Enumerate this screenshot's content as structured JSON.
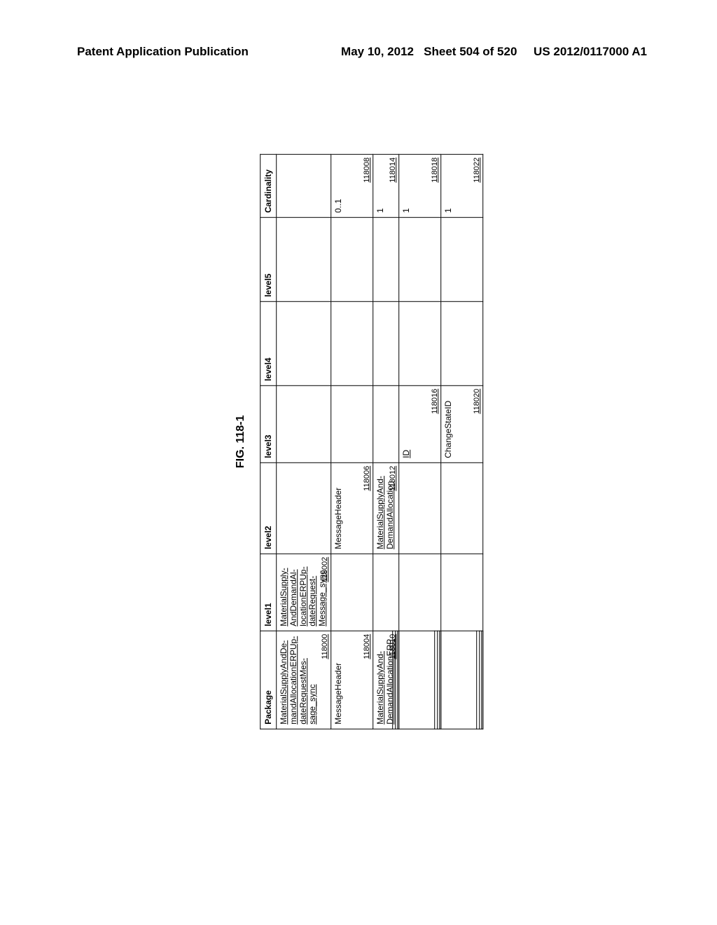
{
  "header": {
    "left": "Patent Application Publication",
    "right_date": "May 10, 2012",
    "right_sheet": "Sheet 504 of 520",
    "right_pubno": "US 2012/0117000 A1"
  },
  "figure": {
    "title": "FIG. 118-1",
    "columns": {
      "package": "Package",
      "l1": "level1",
      "l2": "level2",
      "l3": "level3",
      "l4": "level4",
      "l5": "level5",
      "card": "Cardinality"
    },
    "rows": [
      {
        "package_label": "MaterialSupplyAndDe-mandAllocationERPUp-dateRequestMes-sage_sync",
        "package_ref": "118000",
        "l1_label": "MaterialSupply-AndDemandAl-locationERPUp-dateRequest-Message_sync",
        "l1_ref": "118002",
        "l2_label": "",
        "l2_ref": "",
        "l3_label": "",
        "l3_ref": "",
        "l4_label": "",
        "l5_label": "",
        "card": ""
      },
      {
        "package_label": "MessageHeader",
        "package_ref": "118004",
        "l1_label": "",
        "l1_ref": "",
        "l2_label": "MessageHeader",
        "l2_ref": "118006",
        "l3_label": "",
        "l3_ref": "",
        "l4_label": "",
        "l5_label": "",
        "card": "0..1",
        "card_ref": "118008"
      },
      {
        "package_label": "MaterialSupplyAnd-DemandAllocationERP",
        "package_ref": "118010",
        "package_stripe": true,
        "l1_label": "",
        "l1_ref": "",
        "l2_label": "MaterialSupplyAnd-DemandAllocation",
        "l2_ref": "118012",
        "l3_label": "",
        "l3_ref": "",
        "l4_label": "",
        "l5_label": "",
        "card": "1",
        "card_ref": "118014"
      },
      {
        "package_label": "",
        "package_ref": "",
        "package_stripe": true,
        "l1_label": "",
        "l1_ref": "",
        "l2_label": "",
        "l2_ref": "",
        "l3_label": "ID",
        "l3_ref": "118016",
        "l4_label": "",
        "l5_label": "",
        "card": "1",
        "card_ref": "118018"
      },
      {
        "package_label": "",
        "package_ref": "",
        "package_stripe": true,
        "l1_label": "",
        "l1_ref": "",
        "l2_label": "",
        "l2_ref": "",
        "l3_label": "ChangeStateID",
        "l3_ref": "118020",
        "l4_label": "",
        "l5_label": "",
        "card": "1",
        "card_ref": "118022"
      }
    ]
  }
}
